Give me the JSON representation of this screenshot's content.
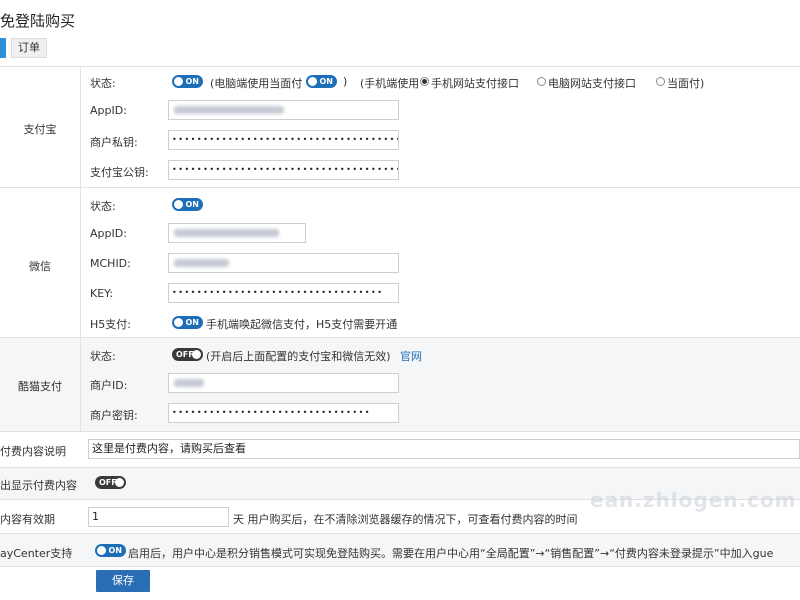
{
  "page": {
    "title": "免登陆购买",
    "tab_order": "订单"
  },
  "alipay": {
    "section_label": "支付宝",
    "status_label": "状态:",
    "status_toggle": "ON",
    "text_open": "(电脑端使用当面付",
    "pc_f2f_toggle": "ON",
    "text_close": ")",
    "mobile_label": "(手机端使用",
    "radio_mobile_web": "手机网站支付接口",
    "radio_pc_web": "电脑网站支付接口",
    "radio_f2f": "当面付)",
    "selected_radio": "手机网站支付接口",
    "appid_label": "AppID:",
    "private_key_label": "商户私钥:",
    "private_key_value": "••••••••••••••••••••••••••••••••••••••••••••••••••••••••••••••••••••••",
    "public_key_label": "支付宝公钥:",
    "public_key_value": "••••••••••••••••••••••••••••••••••••••••••••••••••••••••••••••••••••••"
  },
  "wechat": {
    "section_label": "微信",
    "status_label": "状态:",
    "status_toggle": "ON",
    "appid_label": "AppID:",
    "mchid_label": "MCHID:",
    "key_label": "KEY:",
    "key_value": "••••••••••••••••••••••••••••••••••",
    "h5_label": "H5支付:",
    "h5_toggle": "ON",
    "h5_note": "手机端唤起微信支付，H5支付需要开通"
  },
  "kumao": {
    "section_label": "酷猫支付",
    "status_label": "状态:",
    "status_toggle": "OFF",
    "status_note": "(开启后上面配置的支付宝和微信无效)",
    "official_link": "官网",
    "merchant_id_label": "商户ID:",
    "merchant_key_label": "商户密钥:",
    "merchant_key_value": "••••••••••••••••••••••••••••••••"
  },
  "paid_desc": {
    "label": "付费内容说明",
    "value": "这里是付费内容，请购买后查看"
  },
  "show_paid": {
    "label": "出显示付费内容",
    "toggle": "OFF"
  },
  "validity": {
    "label": "内容有效期",
    "value": "1",
    "note": "天 用户购买后，在不清除浏览器缓存的情况下，可查看付费内容的时间"
  },
  "paycenter": {
    "label": "ayCenter支持",
    "toggle": "ON",
    "note": "启用后，用户中心是积分销售模式可实现免登陆购买。需要在用户中心用“全局配置”→“销售配置”→“付费内容未登录提示”中加入gue"
  },
  "save_label": "保存",
  "watermark": "ean.zhlogen.com",
  "colors": {
    "accent": "#2f8fd8",
    "toggle_on": "#1c6fb7",
    "toggle_off": "#3a3a3a",
    "save": "#2a6fb5",
    "band": "#f5f6f7"
  }
}
